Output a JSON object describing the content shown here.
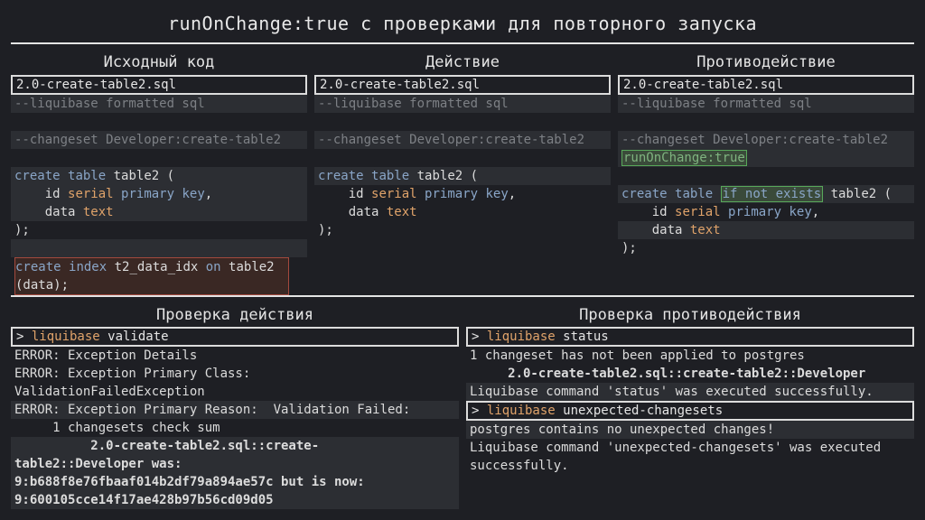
{
  "title": "runOnChange:true с проверками для повторного запуска",
  "columns": {
    "source": {
      "heading": "Исходный код",
      "file": "2.0-create-table2.sql",
      "comment1": "--liquibase formatted sql",
      "comment2": "--changeset Developer:create-table2",
      "create_kw1": "create",
      "create_kw2": "table",
      "create_rest": " table2 (",
      "id_name": "    id ",
      "id_type": "serial",
      "id_kw": "primary key",
      "id_comma": ",",
      "data_name": "    data ",
      "data_type": "text",
      "close": ");",
      "idx_kw1": "create",
      "idx_kw2": "index",
      "idx_name": " t2_data_idx ",
      "idx_on": "on",
      "idx_table": " table2",
      "idx_line2": "(data);"
    },
    "action": {
      "heading": "Действие",
      "file": "2.0-create-table2.sql",
      "comment1": "--liquibase formatted sql",
      "comment2": "--changeset Developer:create-table2",
      "create_kw1": "create",
      "create_kw2": "table",
      "create_rest": " table2 (",
      "id_name": "    id ",
      "id_type": "serial",
      "id_kw": "primary key",
      "id_comma": ",",
      "data_name": "    data ",
      "data_type": "text",
      "close": ");"
    },
    "counter": {
      "heading": "Противодействие",
      "file": "2.0-create-table2.sql",
      "comment1": "--liquibase formatted sql",
      "comment2": "--changeset Developer:create-table2",
      "run_on_change": "runOnChange:true",
      "create_kw1": "create",
      "create_kw2": "table",
      "if_not_exists": "if not exists",
      "create_rest": " table2 (",
      "id_name": "    id ",
      "id_type": "serial",
      "id_kw": "primary key",
      "id_comma": ",",
      "data_name": "    data ",
      "data_type": "text",
      "close": ");"
    }
  },
  "check_action": {
    "heading": "Проверка действия",
    "prompt": "> ",
    "cmd_tool": "liquibase",
    "cmd_arg": " validate",
    "lines": [
      "ERROR: Exception Details",
      "ERROR: Exception Primary Class:",
      "ValidationFailedException",
      "ERROR: Exception Primary Reason:  Validation Failed:",
      "     1 changesets check sum"
    ],
    "bold_lines": [
      "          2.0-create-table2.sql::create-",
      "table2::Developer was:",
      "9:b688f8e76fbaaf014b2df79a894ae57c but is now:",
      "9:600105cce14f17ae428b97b56cd09d05"
    ]
  },
  "check_counter": {
    "heading": "Проверка противодействия",
    "prompt": "> ",
    "cmd1_tool": "liquibase",
    "cmd1_arg": " status",
    "status_line1": "1 changeset has not been applied to postgres",
    "status_line2": "     2.0-create-table2.sql::create-table2::Developer",
    "status_line3": "Liquibase command 'status' was executed successfully.",
    "cmd2_tool": "liquibase",
    "cmd2_arg": " unexpected-changesets",
    "unexp_line1": "postgres contains no unexpected changes!",
    "unexp_line2": "Liquibase command 'unexpected-changesets' was executed",
    "unexp_line3": "successfully."
  }
}
